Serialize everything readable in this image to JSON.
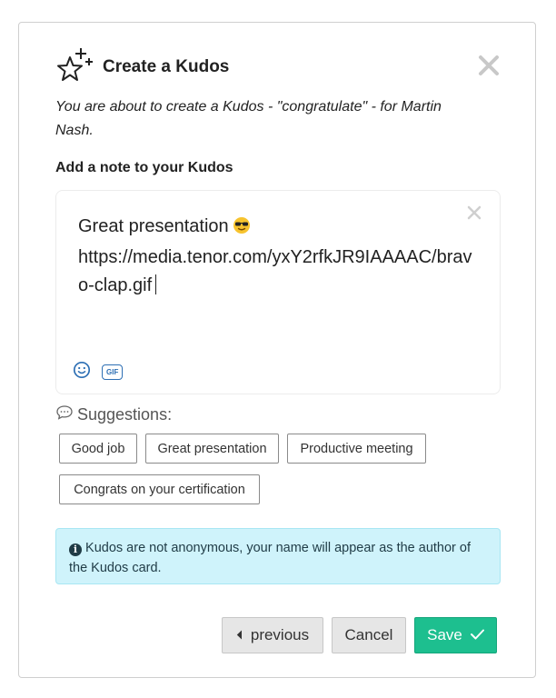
{
  "dialog": {
    "title": "Create a Kudos",
    "intro": "You are about to create a Kudos - \"congratulate\" - for Martin Nash.",
    "note_label": "Add a note to your Kudos"
  },
  "editor": {
    "line1": "Great presentation",
    "emoji": "smiling-face-with-sunglasses",
    "url": "https://media.tenor.com/yxY2rfkJR9IAAAAC/bravo-clap.gif",
    "gif_label": "GIF"
  },
  "suggestions": {
    "heading": "Suggestions:",
    "chips": [
      "Good job",
      "Great presentation",
      "Productive meeting",
      "Congrats on your certification"
    ]
  },
  "info": {
    "text": "Kudos are not anonymous, your name will appear as the author of the Kudos card."
  },
  "buttons": {
    "previous": "previous",
    "cancel": "Cancel",
    "save": "Save"
  },
  "colors": {
    "save_bg": "#1dbf8f",
    "info_bg": "#cff3fb",
    "icon_blue": "#2d6fb4"
  }
}
